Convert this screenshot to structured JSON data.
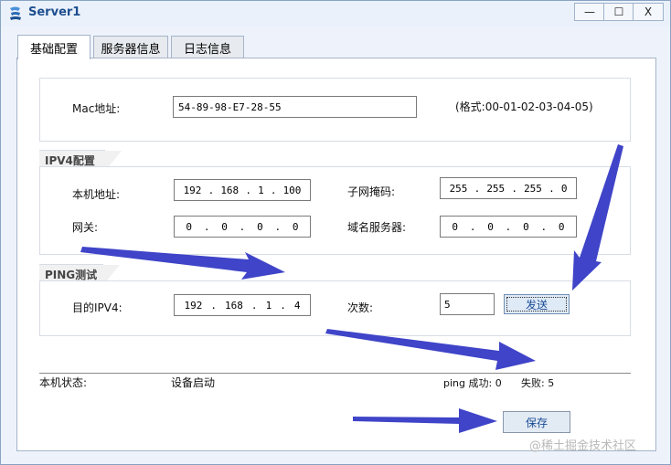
{
  "window": {
    "title": "Server1",
    "controls": {
      "minimize": "—",
      "maximize": "☐",
      "close": "X"
    }
  },
  "tabs": [
    {
      "label": "基础配置",
      "active": true
    },
    {
      "label": "服务器信息",
      "active": false
    },
    {
      "label": "日志信息",
      "active": false
    }
  ],
  "mac": {
    "label": "Mac地址:",
    "value": "54-89-98-E7-28-55",
    "format_hint": "(格式:00-01-02-03-04-05)"
  },
  "ipv4": {
    "section_title": "IPV4配置",
    "local_ip_label": "本机地址:",
    "local_ip": [
      "192",
      "168",
      "1",
      "100"
    ],
    "subnet_label": "子网掩码:",
    "subnet": [
      "255",
      "255",
      "255",
      "0"
    ],
    "gateway_label": "网关:",
    "gateway": [
      "0",
      "0",
      "0",
      "0"
    ],
    "dns_label": "域名服务器:",
    "dns": [
      "0",
      "0",
      "0",
      "0"
    ]
  },
  "ping": {
    "section_title": "PING测试",
    "target_label": "目的IPV4:",
    "target": [
      "192",
      "168",
      "1",
      "4"
    ],
    "count_label": "次数:",
    "count": "5",
    "send_label": "发送"
  },
  "status": {
    "label": "本机状态:",
    "value": "设备启动",
    "ping_success": "ping 成功: 0",
    "fail": "失败: 5"
  },
  "save_label": "保存",
  "watermark": "@稀土掘金技术社区",
  "colors": {
    "arrow": "#3f44c8",
    "title": "#1e4f8f"
  }
}
